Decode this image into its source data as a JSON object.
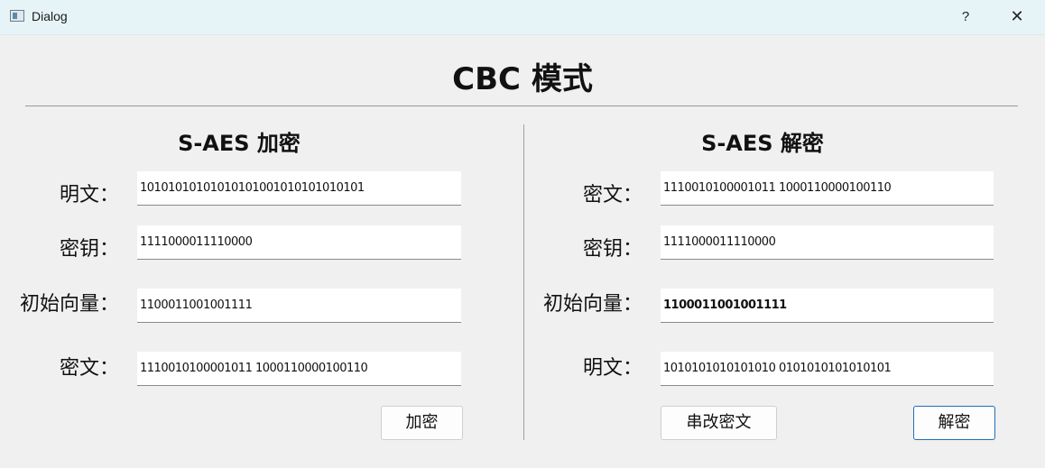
{
  "window": {
    "title": "Dialog",
    "help_label": "?",
    "close_label": "✕"
  },
  "main_title": "CBC 模式",
  "encrypt": {
    "title": "S-AES 加密",
    "plaintext_label": "明文：",
    "plaintext_value": "10101010101010101001010101010101",
    "key_label": "密钥：",
    "key_value": "1111000011110000",
    "iv_label": "初始向量：",
    "iv_value": "1100011001001111",
    "ciphertext_label": "密文：",
    "ciphertext_value": "1110010100001011 1000110000100110",
    "encrypt_button": "加密"
  },
  "decrypt": {
    "title": "S-AES 解密",
    "ciphertext_label": "密文：",
    "ciphertext_value": "1110010100001011 1000110000100110",
    "key_label": "密钥：",
    "key_value": "1111000011110000",
    "iv_label": "初始向量：",
    "iv_value": "1100011001001111",
    "plaintext_label": "明文：",
    "plaintext_value": "1010101010101010 0101010101010101",
    "tamper_button": "串改密文",
    "decrypt_button": "解密"
  },
  "colors": {
    "titlebar": "#e6f4f7",
    "background": "#f0f0f0",
    "focus_border": "#1f6fb8"
  }
}
